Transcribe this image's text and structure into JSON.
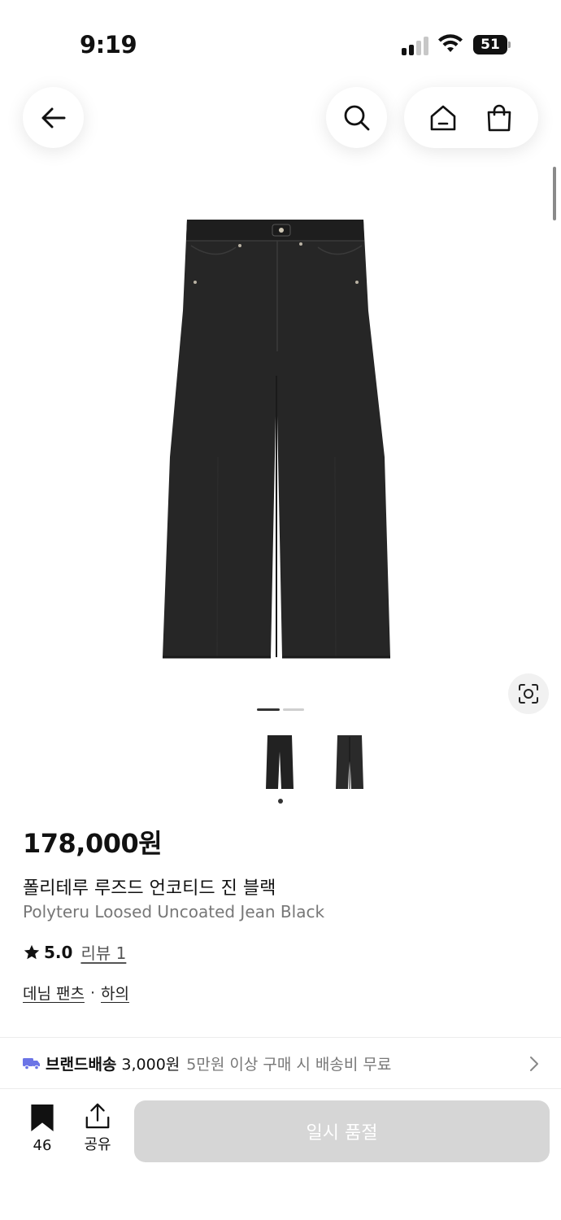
{
  "status_bar": {
    "time": "9:19",
    "battery": "51",
    "icons": [
      "signal-icon",
      "wifi-icon",
      "battery-icon"
    ]
  },
  "nav": {
    "icons": [
      "back-arrow-icon",
      "search-icon",
      "home-icon",
      "shopping-bag-icon"
    ]
  },
  "gallery": {
    "page_count": 2,
    "current_page": 1,
    "thumbnail_count": 2,
    "lens_icon": "lens-search-icon"
  },
  "product": {
    "price": "178,000원",
    "name_ko": "폴리테루 루즈드 언코티드 진 블랙",
    "name_en": "Polyteru Loosed Uncoated Jean Black",
    "rating": "5.0",
    "review_label": "리뷰 1",
    "category": "데님 팬츠",
    "category_separator": "·",
    "category_parent": "하의"
  },
  "shipping": {
    "label": "브랜드배송",
    "fee": "3,000원",
    "note": "5만원 이상 구매 시 배송비 무료",
    "icon": "truck-icon"
  },
  "bottom_bar": {
    "bookmark_count": "46",
    "share_label": "공유",
    "cta_label": "일시 품절"
  },
  "colors": {
    "accent_shipping": "#6b74e6",
    "cta_disabled": "#d6d6d6"
  }
}
